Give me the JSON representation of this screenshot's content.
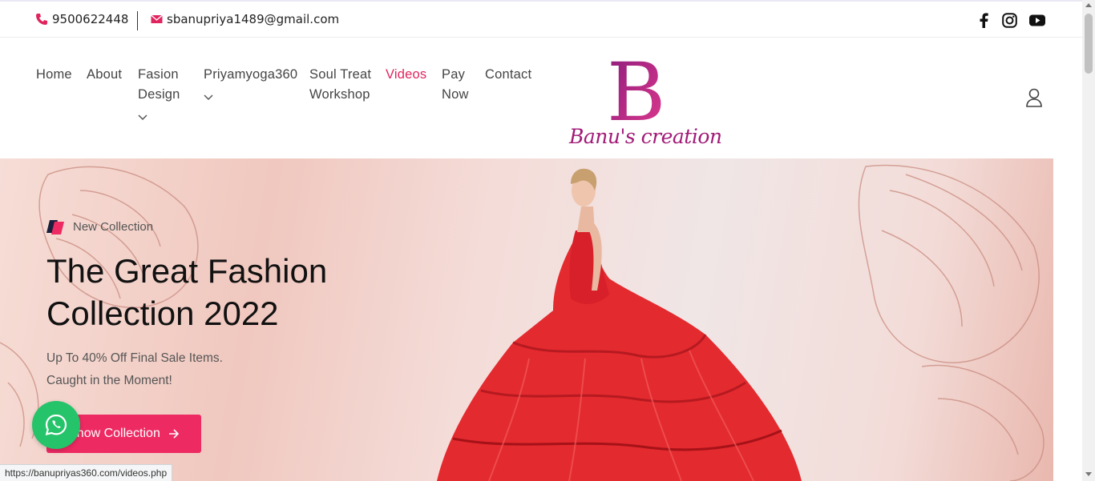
{
  "topbar": {
    "phone": "9500622448",
    "email": "sbanupriya1489@gmail.com",
    "icons": {
      "phone": "phone-icon",
      "email": "envelope-icon",
      "facebook": "facebook-icon",
      "instagram": "instagram-icon",
      "youtube": "youtube-icon"
    }
  },
  "nav": {
    "items": [
      {
        "label": "Home"
      },
      {
        "label": "About"
      },
      {
        "label": "Fasion Design",
        "has_dropdown": true
      },
      {
        "label": "Priyamyoga360",
        "has_dropdown": true
      },
      {
        "label": "Soul Treat Workshop"
      },
      {
        "label": "Videos",
        "active": true
      },
      {
        "label": "Pay Now"
      },
      {
        "label": "Contact"
      }
    ],
    "user_icon": "user-icon"
  },
  "logo": {
    "letter": "B",
    "text": "Banu's creation"
  },
  "hero": {
    "badge": "New Collection",
    "title": "The Great Fashion Collection 2022",
    "subtitle_line1": "Up To 40% Off Final Sale Items.",
    "subtitle_line2": "Caught in the Moment!",
    "cta_label": "Show Collection"
  },
  "status_bar": {
    "url": "https://banupriyas360.com/videos.php"
  },
  "colors": {
    "accent": "#ee2a63",
    "nav_active": "#e0245e",
    "logo": "#a11a78",
    "whatsapp": "#25c36a"
  }
}
